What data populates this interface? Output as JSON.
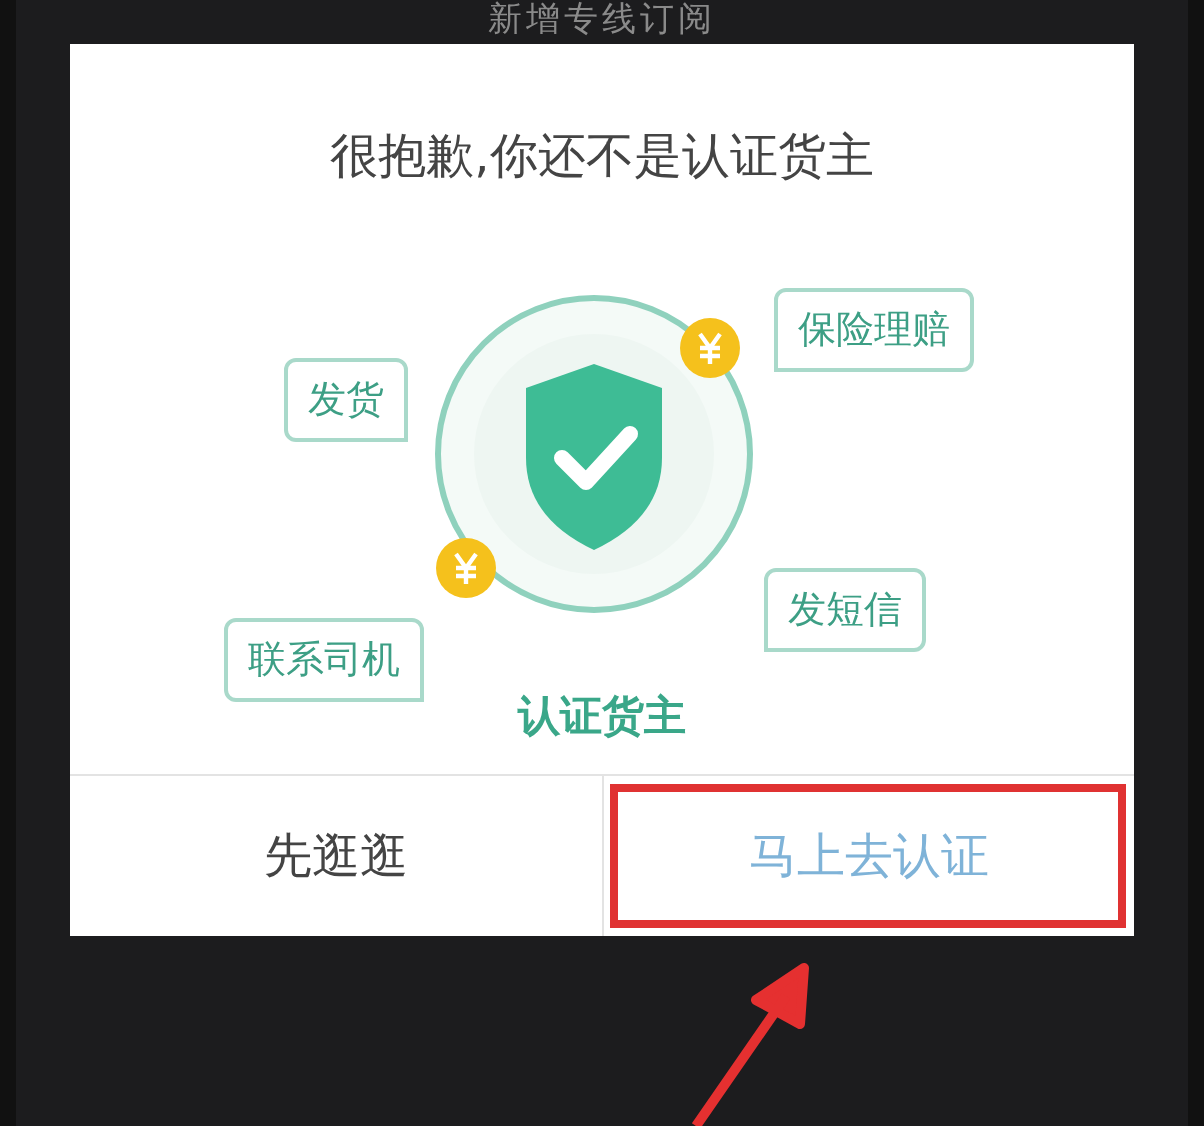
{
  "background": {
    "title": "新增专线订阅"
  },
  "dialog": {
    "title": "很抱歉,你还不是认证货主",
    "bubbles": [
      {
        "label": "保险理赔",
        "kind": "right"
      },
      {
        "label": "发货",
        "kind": "left"
      },
      {
        "label": "发短信",
        "kind": "right"
      },
      {
        "label": "联系司机",
        "kind": "left"
      }
    ],
    "caption": "认证货主",
    "buttons": [
      {
        "label": "先逛逛",
        "kind": "secondary",
        "highlighted": false
      },
      {
        "label": "马上去认证",
        "kind": "primary",
        "highlighted": true
      }
    ]
  }
}
